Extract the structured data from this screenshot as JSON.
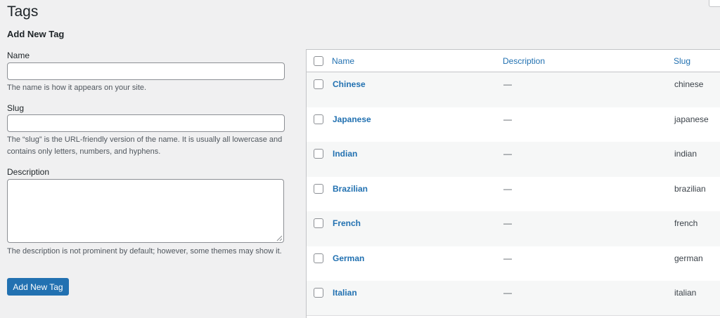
{
  "page": {
    "title": "Tags"
  },
  "form": {
    "heading": "Add New Tag",
    "name_label": "Name",
    "name_value": "",
    "name_help": "The name is how it appears on your site.",
    "slug_label": "Slug",
    "slug_value": "",
    "slug_help": "The “slug” is the URL-friendly version of the name. It is usually all lowercase and contains only letters, numbers, and hyphens.",
    "description_label": "Description",
    "description_value": "",
    "description_help": "The description is not prominent by default; however, some themes may show it.",
    "submit_label": "Add New Tag"
  },
  "table": {
    "columns": {
      "name": "Name",
      "description": "Description",
      "slug": "Slug"
    },
    "rows": [
      {
        "name": "Chinese",
        "description": "—",
        "slug": "chinese"
      },
      {
        "name": "Japanese",
        "description": "—",
        "slug": "japanese"
      },
      {
        "name": "Indian",
        "description": "—",
        "slug": "indian"
      },
      {
        "name": "Brazilian",
        "description": "—",
        "slug": "brazilian"
      },
      {
        "name": "French",
        "description": "—",
        "slug": "french"
      },
      {
        "name": "German",
        "description": "—",
        "slug": "german"
      },
      {
        "name": "Italian",
        "description": "—",
        "slug": "italian"
      }
    ]
  },
  "colors": {
    "accent": "#2271b1",
    "background": "#f0f0f1",
    "stripe": "#f6f7f7"
  }
}
